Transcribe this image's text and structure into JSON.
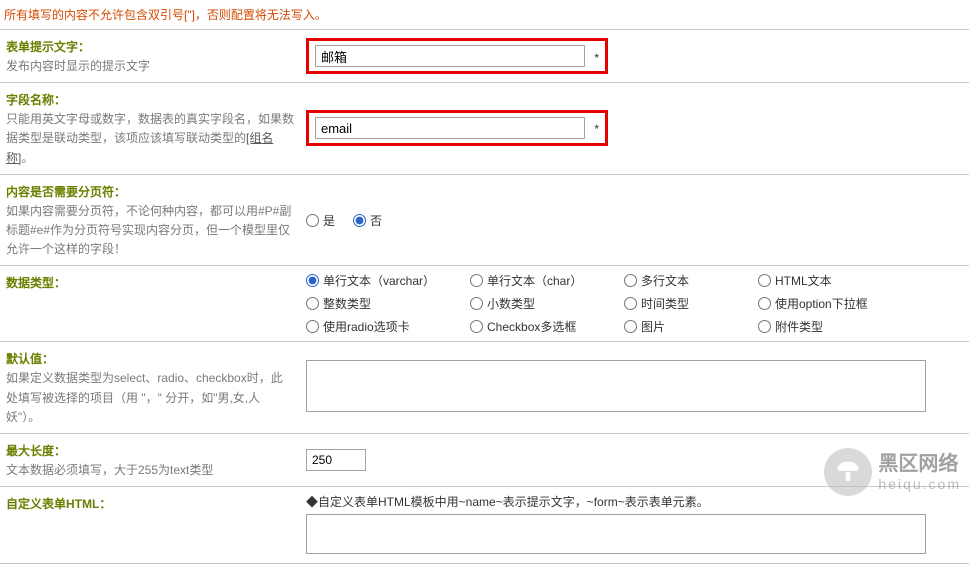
{
  "warning": "所有填写的内容不允许包含双引号[\"]，否则配置将无法写入。",
  "rows": {
    "display_text": {
      "label": "表单提示文字：",
      "desc": "发布内容时显示的提示文字",
      "value": "邮箱"
    },
    "field_name": {
      "label": "字段名称：",
      "desc_before": "只能用英文字母或数字，数据表的真实字段名，如果数据类型是联动类型，该项应该填写联动类型的",
      "desc_link": "[组名称]",
      "desc_after": "。",
      "value": "email"
    },
    "pagination": {
      "label": "内容是否需要分页符：",
      "desc": "如果内容需要分页符，不论何种内容，都可以用#P#副标题#e#作为分页符号实现内容分页，但一个模型里仅允许一个这样的字段！",
      "option_yes": "是",
      "option_no": "否",
      "value": "no"
    },
    "datatype": {
      "label": "数据类型：",
      "options": [
        "单行文本（varchar）",
        "单行文本（char）",
        "多行文本",
        "HTML文本",
        "整数类型",
        "小数类型",
        "时间类型",
        "使用option下拉框",
        "使用radio选项卡",
        "Checkbox多选框",
        "图片",
        "附件类型"
      ],
      "selected_index": 0
    },
    "default_val": {
      "label": "默认值：",
      "desc": "如果定义数据类型为select、radio、checkbox时，此处填写被选择的项目（用 \"，\" 分开，如\"男,女,人妖\"）。",
      "value": ""
    },
    "max_length": {
      "label": "最大长度：",
      "desc": "文本数据必须填写，大于255为text类型",
      "value": "250"
    },
    "custom_html": {
      "label": "自定义表单HTML：",
      "hint": "◆自定义表单HTML模板中用~name~表示提示文字，~form~表示表单元素。",
      "value": ""
    }
  },
  "watermark": {
    "cn": "黑区网络",
    "en": "heiqu.com"
  }
}
